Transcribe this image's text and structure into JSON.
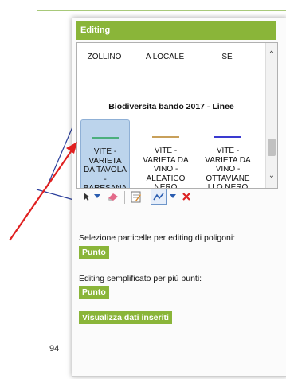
{
  "panel": {
    "title": "Editing"
  },
  "template_picker": {
    "cut_items": [
      "ZOLLINO",
      "A LOCALE",
      "SE"
    ],
    "group_title": "Biodiversita bando 2017 - Linee",
    "templates": [
      {
        "label": "VITE - VARIETA DA TAVOLA - BARESANA BIANCA",
        "color": "#4caf7d",
        "selected": true
      },
      {
        "label": "VITE - VARIETA DA VINO - ALEATICO NERO",
        "color": "#c8a05a",
        "selected": false
      },
      {
        "label": "VITE - VARIETA DA VINO - OTTAVIANE LLO NERO",
        "color": "#3a3ad0",
        "selected": false
      }
    ]
  },
  "toolbar": {
    "icons": [
      "select-arrow-icon",
      "dropdown-icon",
      "eraser-icon",
      "edit-attributes-icon",
      "line-draw-icon",
      "dropdown-icon",
      "delete-icon"
    ]
  },
  "polygon_section": {
    "label": "Selezione particelle per editing di poligoni:",
    "button": "Punto"
  },
  "points_section": {
    "label": "Editing semplificato per più punti:",
    "button": "Punto"
  },
  "view_button": "Visualizza dati inseriti",
  "background": {
    "number_fragment": "94"
  },
  "colors": {
    "accent_green": "#8ab539",
    "selection_blue": "#bcd4ec",
    "annotation_red": "#e02020"
  }
}
